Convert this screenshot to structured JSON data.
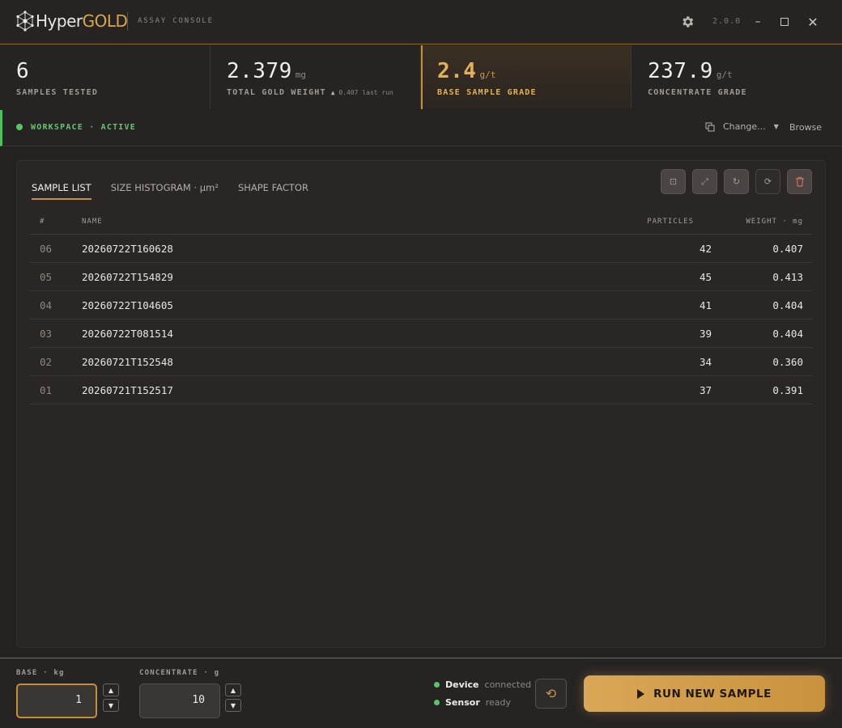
{
  "app": {
    "logo_hyper": "Hyper",
    "logo_gold": "GOLD",
    "subtitle": "ASSAY CONSOLE",
    "version": "2.0.0"
  },
  "stats": [
    {
      "value": "6",
      "unit": "",
      "label": "SAMPLES TESTED"
    },
    {
      "value": "2.379",
      "unit": "mg",
      "label": "TOTAL GOLD WEIGHT",
      "sub": "0.407 last run"
    },
    {
      "value": "2.4",
      "unit": "g/t",
      "label": "BASE SAMPLE GRADE"
    },
    {
      "value": "237.9",
      "unit": "g/t",
      "label": "CONCENTRATE GRADE"
    }
  ],
  "workspace": {
    "status": "WORKSPACE · ACTIVE",
    "change_label": "Change...",
    "browse_label": "Browse"
  },
  "tabs": [
    {
      "label": "SAMPLE LIST",
      "active": true
    },
    {
      "label": "SIZE HISTOGRAM · µm²",
      "active": false
    },
    {
      "label": "SHAPE FACTOR",
      "active": false
    }
  ],
  "table": {
    "headers": {
      "idx": "#",
      "name": "NAME",
      "particles": "PARTICLES",
      "weight": "WEIGHT · mg"
    },
    "rows": [
      {
        "idx": "06",
        "name": "20260722T160628",
        "particles": "42",
        "weight": "0.407"
      },
      {
        "idx": "05",
        "name": "20260722T154829",
        "particles": "45",
        "weight": "0.413"
      },
      {
        "idx": "04",
        "name": "20260722T104605",
        "particles": "41",
        "weight": "0.404"
      },
      {
        "idx": "03",
        "name": "20260722T081514",
        "particles": "39",
        "weight": "0.404"
      },
      {
        "idx": "02",
        "name": "20260721T152548",
        "particles": "34",
        "weight": "0.360"
      },
      {
        "idx": "01",
        "name": "20260721T152517",
        "particles": "37",
        "weight": "0.391"
      }
    ]
  },
  "inputs": {
    "base": {
      "label": "BASE · kg",
      "value": "1"
    },
    "concentrate": {
      "label": "CONCENTRATE · g",
      "value": "10"
    }
  },
  "status": {
    "device_name": "Device",
    "device_state": "connected",
    "sensor_name": "Sensor",
    "sensor_state": "ready"
  },
  "run_button": {
    "label": "RUN NEW SAMPLE"
  },
  "colors": {
    "accent": "#c48f36",
    "gold_text": "#e5b052",
    "active_green": "#58c766",
    "danger": "#d96a55",
    "background": "#242121"
  }
}
